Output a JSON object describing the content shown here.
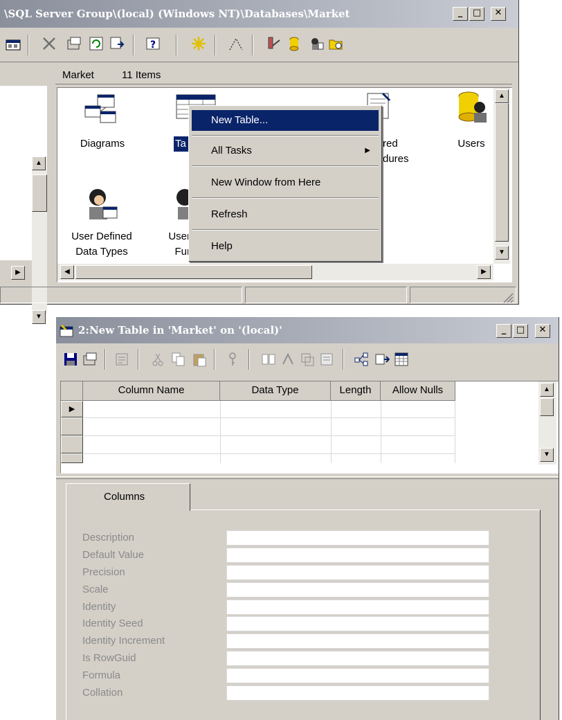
{
  "explorer_window": {
    "title": "\\SQL Server Group\\(local) (Windows NT)\\Databases\\Market",
    "controls": {
      "minimize": "_",
      "maximize": "□",
      "close": "✕"
    },
    "pane_header": {
      "name": "Market",
      "count": "11 Items"
    },
    "items": [
      {
        "label": "Diagrams",
        "icon": "diagrams-icon"
      },
      {
        "label": "Ta",
        "icon": "tables-icon"
      },
      {
        "label": "red\ndures",
        "icon": "stored-procedures-icon"
      },
      {
        "label": "Users",
        "icon": "users-icon"
      },
      {
        "label": "User Defined\nData Types",
        "icon": "user-defined-data-types-icon"
      },
      {
        "label": "User\nFur",
        "icon": "user-defined-functions-icon"
      }
    ]
  },
  "context_menu": {
    "items": [
      {
        "label": "New Table..."
      },
      {
        "label": "All Tasks",
        "submenu_arrow": "▶"
      },
      {
        "label": "New Window from Here"
      },
      {
        "label": "Refresh"
      },
      {
        "label": "Help"
      }
    ]
  },
  "table_window": {
    "title": "2:New Table in 'Market' on '(local)'",
    "controls": {
      "minimize": "_",
      "maximize": "□",
      "close": "✕"
    },
    "columns": [
      "Column Name",
      "Data Type",
      "Length",
      "Allow Nulls"
    ],
    "current_row_marker": "▶",
    "tab_label": "Columns",
    "properties": [
      "Description",
      "Default Value",
      "Precision",
      "Scale",
      "Identity",
      "Identity Seed",
      "Identity Increment",
      "Is RowGuid",
      "Formula",
      "Collation"
    ]
  },
  "scroll_arrows": {
    "up": "▲",
    "down": "▼",
    "left": "◀",
    "right": "▶"
  }
}
